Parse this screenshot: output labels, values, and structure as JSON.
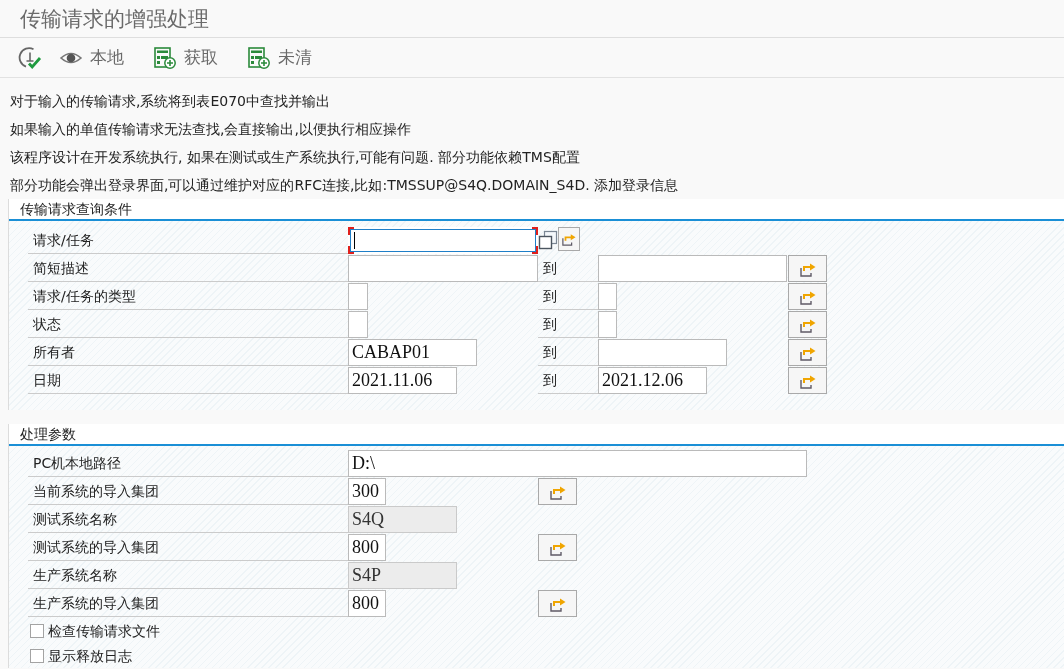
{
  "window": {
    "title": "传输请求的增强处理"
  },
  "toolbar": [
    {
      "kind": "execute"
    },
    {
      "kind": "view",
      "label": "本地"
    },
    {
      "kind": "list_add",
      "label": "获取"
    },
    {
      "kind": "list_add",
      "label": "未清"
    }
  ],
  "info_lines": [
    "对于输入的传输请求,系统将到表E070中查找并输出",
    "如果输入的单值传输请求无法查找,会直接输出,以便执行相应操作",
    "该程序设计在开发系统执行, 如果在测试或生产系统执行,可能有问题. 部分功能依赖TMS配置",
    "部分功能会弹出登录界面,可以通过维护对应的RFC连接,比如:TMSSUP@S4Q.DOMAIN_S4D. 添加登录信息"
  ],
  "groups": [
    {
      "title": "传输请求查询条件",
      "rows": [
        {
          "kind": "select_single",
          "label": "请求/任务",
          "focused": true
        },
        {
          "kind": "range",
          "label": "简短描述",
          "to_label": "到",
          "focused": false
        },
        {
          "kind": "range",
          "label": "请求/任务的类型",
          "to_label": "到",
          "focused": false
        },
        {
          "kind": "range",
          "label": "状态",
          "to_label": "到",
          "focused": false
        },
        {
          "kind": "range",
          "label": "所有者",
          "low": "CABAP01",
          "to_label": "到",
          "focused": false
        },
        {
          "kind": "range",
          "label": "日期",
          "low": "2021.11.06",
          "to_label": "到",
          "high": "2021.12.06",
          "focused": false
        }
      ]
    },
    {
      "title": "处理参数",
      "rows": [
        {
          "kind": "parameter",
          "label": "PC机本地路径",
          "value": "D:\\",
          "readonly": false,
          "multi_select": false,
          "focused": false
        },
        {
          "kind": "parameter",
          "label": "当前系统的导入集团",
          "value": "300",
          "readonly": false,
          "multi_select": true,
          "focused": false
        },
        {
          "kind": "parameter",
          "label": "测试系统名称",
          "value": "S4Q",
          "readonly": true,
          "multi_select": false,
          "focused": false
        },
        {
          "kind": "parameter",
          "label": "测试系统的导入集团",
          "value": "800",
          "readonly": false,
          "multi_select": true,
          "focused": false
        },
        {
          "kind": "parameter",
          "label": "生产系统名称",
          "value": "S4P",
          "readonly": true,
          "multi_select": false,
          "focused": false
        },
        {
          "kind": "parameter",
          "label": "生产系统的导入集团",
          "value": "800",
          "readonly": false,
          "multi_select": true,
          "focused": false
        },
        {
          "kind": "checkbox",
          "label": "检查传输请求文件",
          "checked": false
        },
        {
          "kind": "checkbox",
          "label": "显示释放日志",
          "checked": false
        }
      ]
    }
  ]
}
